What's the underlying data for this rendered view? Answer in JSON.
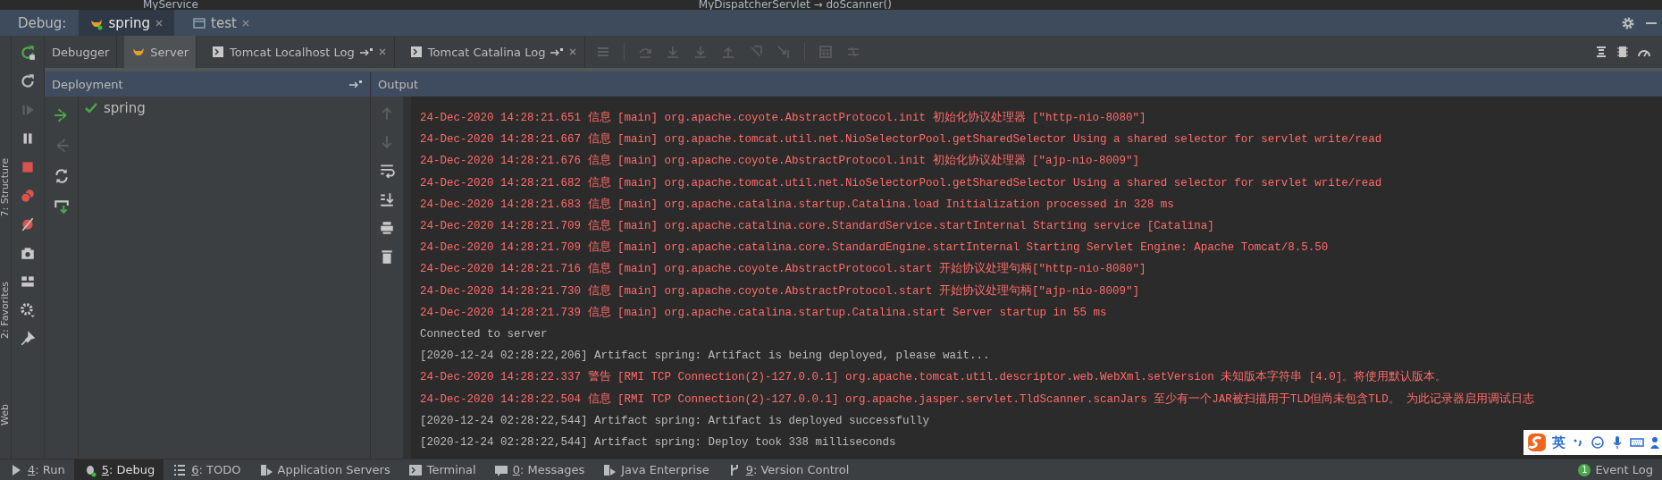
{
  "editor_strip": {
    "file_tab": "MyService",
    "breadcrumb": "MyDispatcherServlet → doScanner()"
  },
  "debug_bar": {
    "title": "Debug:",
    "tabs": [
      {
        "label": "spring",
        "kind": "server",
        "selected": true
      },
      {
        "label": "test",
        "kind": "window",
        "selected": false
      }
    ]
  },
  "sub_tabs": [
    {
      "label": "Debugger",
      "kind": "plain",
      "selected": false
    },
    {
      "label": "Server",
      "kind": "server",
      "selected": true
    },
    {
      "label": "Tomcat Localhost Log",
      "kind": "log",
      "selected": false
    },
    {
      "label": "Tomcat Catalina Log",
      "kind": "log",
      "selected": false
    }
  ],
  "left_rail": [
    "7: Structure",
    "2: Favorites",
    "Web"
  ],
  "deployment": {
    "header": "Deployment",
    "items": [
      {
        "label": "spring",
        "deployed": true
      }
    ]
  },
  "output": {
    "header": "Output",
    "lines": [
      {
        "kind": "stderr",
        "text": "24-Dec-2020 14:28:21.651 信息 [main] org.apache.coyote.AbstractProtocol.init 初始化协议处理器 [\"http-nio-8080\"]"
      },
      {
        "kind": "stderr",
        "text": "24-Dec-2020 14:28:21.667 信息 [main] org.apache.tomcat.util.net.NioSelectorPool.getSharedSelector Using a shared selector for servlet write/read"
      },
      {
        "kind": "stderr",
        "text": "24-Dec-2020 14:28:21.676 信息 [main] org.apache.coyote.AbstractProtocol.init 初始化协议处理器 [\"ajp-nio-8009\"]"
      },
      {
        "kind": "stderr",
        "text": "24-Dec-2020 14:28:21.682 信息 [main] org.apache.tomcat.util.net.NioSelectorPool.getSharedSelector Using a shared selector for servlet write/read"
      },
      {
        "kind": "stderr",
        "text": "24-Dec-2020 14:28:21.683 信息 [main] org.apache.catalina.startup.Catalina.load Initialization processed in 328 ms"
      },
      {
        "kind": "stderr",
        "text": "24-Dec-2020 14:28:21.709 信息 [main] org.apache.catalina.core.StandardService.startInternal Starting service [Catalina]"
      },
      {
        "kind": "stderr",
        "text": "24-Dec-2020 14:28:21.709 信息 [main] org.apache.catalina.core.StandardEngine.startInternal Starting Servlet Engine: Apache Tomcat/8.5.50"
      },
      {
        "kind": "stderr",
        "text": "24-Dec-2020 14:28:21.716 信息 [main] org.apache.coyote.AbstractProtocol.start 开始协议处理句柄[\"http-nio-8080\"]"
      },
      {
        "kind": "stderr",
        "text": "24-Dec-2020 14:28:21.730 信息 [main] org.apache.coyote.AbstractProtocol.start 开始协议处理句柄[\"ajp-nio-8009\"]"
      },
      {
        "kind": "stderr",
        "text": "24-Dec-2020 14:28:21.739 信息 [main] org.apache.catalina.startup.Catalina.start Server startup in 55 ms"
      },
      {
        "kind": "stdout",
        "text": "Connected to server"
      },
      {
        "kind": "stdout",
        "text": "[2020-12-24 02:28:22,206] Artifact spring: Artifact is being deployed, please wait..."
      },
      {
        "kind": "stderr",
        "text": "24-Dec-2020 14:28:22.337 警告 [RMI TCP Connection(2)-127.0.0.1] org.apache.tomcat.util.descriptor.web.WebXml.setVersion 未知版本字符串 [4.0]。将使用默认版本。"
      },
      {
        "kind": "stderr",
        "text": "24-Dec-2020 14:28:22.504 信息 [RMI TCP Connection(2)-127.0.0.1] org.apache.jasper.servlet.TldScanner.scanJars 至少有一个JAR被扫描用于TLD但尚未包含TLD。 为此记录器启用调试日志"
      },
      {
        "kind": "stdout",
        "text": "[2020-12-24 02:28:22,544] Artifact spring: Artifact is deployed successfully"
      },
      {
        "kind": "stdout",
        "text": "[2020-12-24 02:28:22,544] Artifact spring: Deploy took 338 milliseconds"
      }
    ]
  },
  "bottom_bar": {
    "tabs": [
      {
        "key": "4",
        "label": ": Run",
        "kind": "run",
        "selected": false
      },
      {
        "key": "5",
        "label": ": Debug",
        "kind": "debug",
        "selected": true
      },
      {
        "key": "6",
        "label": ": TODO",
        "kind": "todo",
        "selected": false
      },
      {
        "label": "Application Servers",
        "kind": "servers",
        "selected": false
      },
      {
        "label": "Terminal",
        "kind": "terminal",
        "selected": false
      },
      {
        "key": "0",
        "label": ": Messages",
        "kind": "messages",
        "selected": false
      },
      {
        "label": "Java Enterprise",
        "kind": "enterprise",
        "selected": false
      },
      {
        "key": "9",
        "label": ": Version Control",
        "kind": "vcs",
        "selected": false
      }
    ],
    "event_log": {
      "count": "1",
      "label": "Event Log"
    }
  },
  "ime_toolbar": {
    "mode": "英"
  }
}
